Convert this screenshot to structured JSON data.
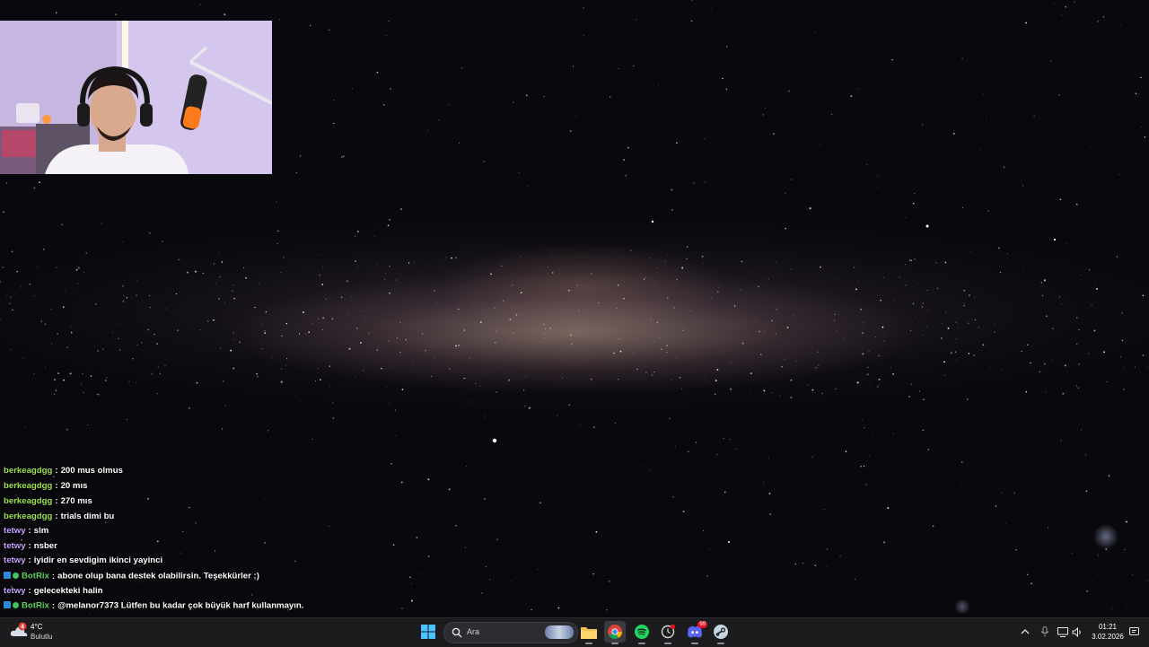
{
  "chat": {
    "lines": [
      {
        "user": "berkeagdgg",
        "color": "#9ce34a",
        "text": "200 mus olmus",
        "bot": false
      },
      {
        "user": "berkeagdgg",
        "color": "#9ce34a",
        "text": "20 mıs",
        "bot": false
      },
      {
        "user": "berkeagdgg",
        "color": "#9ce34a",
        "text": "270 mıs",
        "bot": false
      },
      {
        "user": "berkeagdgg",
        "color": "#9ce34a",
        "text": "trials dimi bu",
        "bot": false
      },
      {
        "user": "tetwy",
        "color": "#c7a4ff",
        "text": "slm",
        "bot": false
      },
      {
        "user": "tetwy",
        "color": "#c7a4ff",
        "text": "nsber",
        "bot": false
      },
      {
        "user": "tetwy",
        "color": "#c7a4ff",
        "text": "iyidir en sevdigim ikinci yayinci",
        "bot": false
      },
      {
        "user": "BotRix",
        "color": "#5ad35a",
        "text": "abone olup bana destek olabilirsin. Teşekkürler :)",
        "bot": true
      },
      {
        "user": "tetwy",
        "color": "#c7a4ff",
        "text": "gelecekteki halin",
        "bot": false
      },
      {
        "user": "BotRix",
        "color": "#5ad35a",
        "text": "@melanor7373 Lütfen bu kadar çok büyük harf kullanmayın.",
        "bot": true
      }
    ],
    "separator": ":"
  },
  "weather": {
    "temp": "4°C",
    "condition": "Bulutlu",
    "badge": "4"
  },
  "search": {
    "placeholder": "Ara"
  },
  "taskbar_apps": [
    {
      "name": "start-button",
      "icon": "windows-icon"
    },
    {
      "name": "file-explorer",
      "icon": "folder-icon"
    },
    {
      "name": "chrome",
      "icon": "chrome-icon"
    },
    {
      "name": "spotify",
      "icon": "spotify-icon"
    },
    {
      "name": "app-notification",
      "icon": "clock-app-icon"
    },
    {
      "name": "discord",
      "icon": "discord-icon"
    },
    {
      "name": "steam",
      "icon": "steam-icon"
    }
  ],
  "clock": {
    "time": "01:21",
    "date": "3.02.2026"
  },
  "discord_badge": "99",
  "colors": {
    "taskbar": "#1c1c1f",
    "accent": "#0078d4"
  }
}
